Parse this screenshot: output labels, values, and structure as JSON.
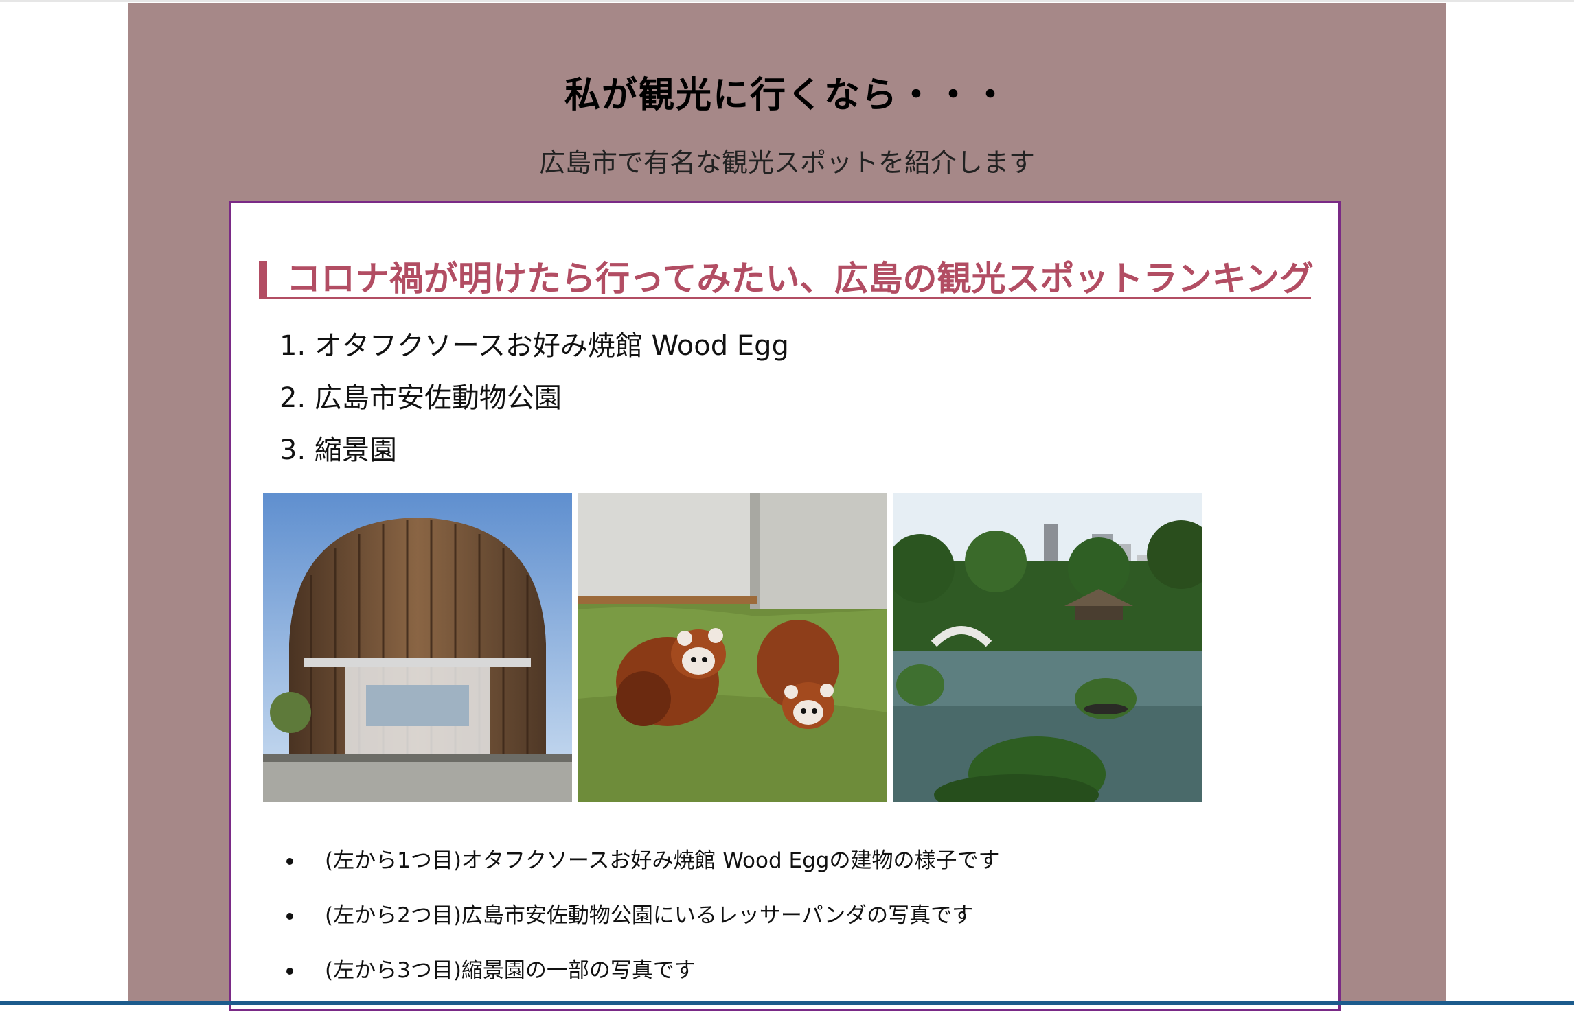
{
  "header": {
    "title": "私が観光に行くなら・・・",
    "subtitle": "広島市で有名な観光スポットを紹介します"
  },
  "section": {
    "heading": "コロナ禍が明けたら行ってみたい、広島の観光スポットランキング"
  },
  "ranking": [
    "1. オタフクソースお好み焼館 Wood Egg",
    "2. 広島市安佐動物公園",
    "3. 縮景園"
  ],
  "photos": [
    {
      "icon": "building-photo"
    },
    {
      "icon": "red-panda-photo"
    },
    {
      "icon": "garden-photo"
    }
  ],
  "captions": [
    "(左から1つ目)オタフクソースお好み焼館 Wood Eggの建物の様子です",
    "(左から2つ目)広島市安佐動物公園にいるレッサーパンダの写真です",
    "(左から3つ目)縮景園の一部の写真です"
  ],
  "colors": {
    "page_background": "#a68888",
    "box_border": "#7a2a86",
    "heading_accent": "#b24d63"
  }
}
